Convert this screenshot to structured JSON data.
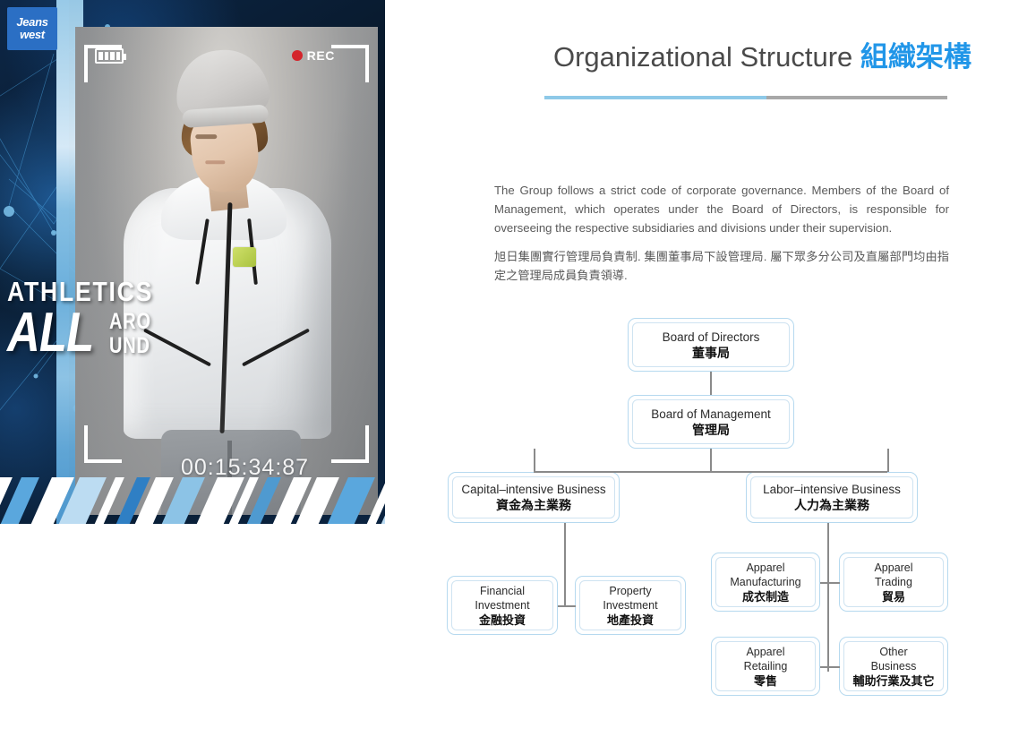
{
  "left_panel": {
    "brand_logo": {
      "line1": "Jeans",
      "line2": "west"
    },
    "hud": {
      "rec_label": "REC",
      "timecode": "00:15:34:87",
      "battery_icon": "battery-icon",
      "bracket_icon": "corner-bracket-icon"
    },
    "campaign": {
      "line1": "ATHLETICS",
      "big": "ALL",
      "small_top": "ARO",
      "small_bottom": "UND"
    },
    "colors": {
      "brand_blue": "#2b6fc4",
      "rec_red": "#d4242b",
      "navy": "#0a1b33",
      "light_blue": "#9fd0ec"
    }
  },
  "header": {
    "title_en": "Organizational Structure ",
    "title_zh": "組織架構",
    "rule_accent": "#8ec9e8",
    "rule_secondary": "#a8a8a8"
  },
  "body": {
    "paragraph_en": "The Group follows a strict code of corporate governance. Members of the Board of Management, which operates under the Board of Directors, is responsible for overseeing the respective subsidiaries and divisions under their supervision.",
    "paragraph_zh": "旭日集團實行管理局負責制. 集團董事局下設管理局. 屬下眾多分公司及直屬部門均由指定之管理局成員負責領導."
  },
  "chart_data": {
    "type": "diagram",
    "title": "Organizational Structure 組織架構",
    "nodes": [
      {
        "id": "board_directors",
        "en": "Board of Directors",
        "zh": "董事局",
        "level": 0
      },
      {
        "id": "board_management",
        "en": "Board of Management",
        "zh": "管理局",
        "level": 1
      },
      {
        "id": "capital_intensive",
        "en": "Capital–intensive Business",
        "zh": "資金為主業務",
        "level": 2
      },
      {
        "id": "labor_intensive",
        "en": "Labor–intensive Business",
        "zh": "人力為主業務",
        "level": 2
      },
      {
        "id": "financial_investment",
        "en": "Financial\nInvestment",
        "zh": "金融投資",
        "level": 3
      },
      {
        "id": "property_investment",
        "en": "Property\nInvestment",
        "zh": "地產投資",
        "level": 3
      },
      {
        "id": "apparel_manufacturing",
        "en": "Apparel\nManufacturing",
        "zh": "成衣制造",
        "level": 3
      },
      {
        "id": "apparel_trading",
        "en": "Apparel\nTrading",
        "zh": "貿易",
        "level": 3
      },
      {
        "id": "apparel_retailing",
        "en": "Apparel\nRetailing",
        "zh": "零售",
        "level": 3
      },
      {
        "id": "other_business",
        "en": "Other\nBusiness",
        "zh": "輔助行業及其它",
        "level": 3
      }
    ],
    "edges": [
      {
        "from": "board_directors",
        "to": "board_management"
      },
      {
        "from": "board_management",
        "to": "capital_intensive"
      },
      {
        "from": "board_management",
        "to": "labor_intensive"
      },
      {
        "from": "capital_intensive",
        "to": "financial_investment"
      },
      {
        "from": "capital_intensive",
        "to": "property_investment"
      },
      {
        "from": "labor_intensive",
        "to": "apparel_manufacturing"
      },
      {
        "from": "labor_intensive",
        "to": "apparel_trading"
      },
      {
        "from": "labor_intensive",
        "to": "apparel_retailing"
      },
      {
        "from": "labor_intensive",
        "to": "other_business"
      }
    ],
    "node_border_color": "#b6d9ef",
    "connector_color": "#8a8a8a"
  }
}
